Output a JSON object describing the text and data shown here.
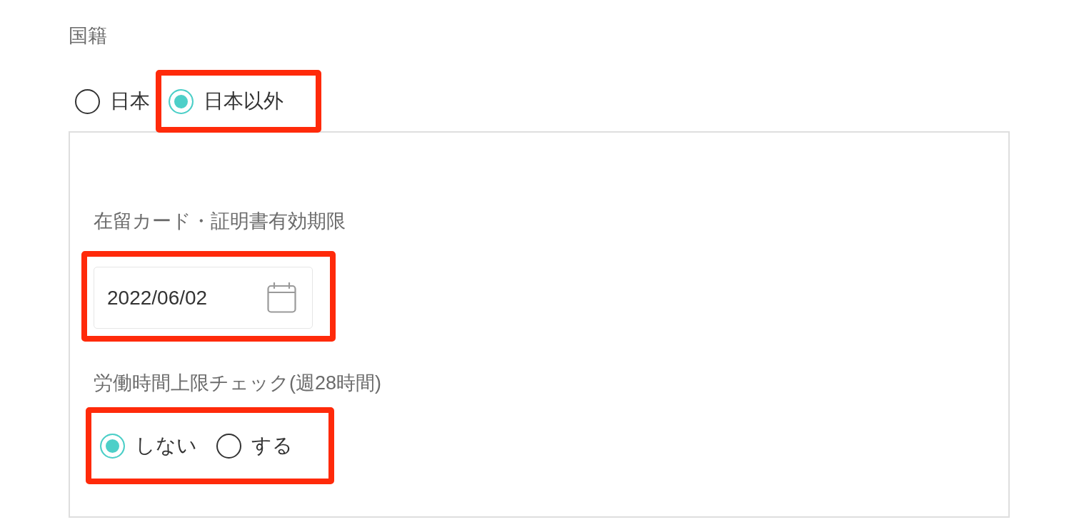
{
  "nationality": {
    "label": "国籍",
    "options": [
      {
        "label": "日本",
        "selected": false,
        "highlighted": false
      },
      {
        "label": "日本以外",
        "selected": true,
        "highlighted": true
      }
    ]
  },
  "foreign_details": {
    "expiry": {
      "label": "在留カード・証明書有効期限",
      "value": "2022/06/02",
      "highlighted": true
    },
    "work_hour_check": {
      "label": "労働時間上限チェック(週28時間)",
      "highlighted": true,
      "options": [
        {
          "label": "しない",
          "selected": true
        },
        {
          "label": "する",
          "selected": false
        }
      ]
    }
  }
}
